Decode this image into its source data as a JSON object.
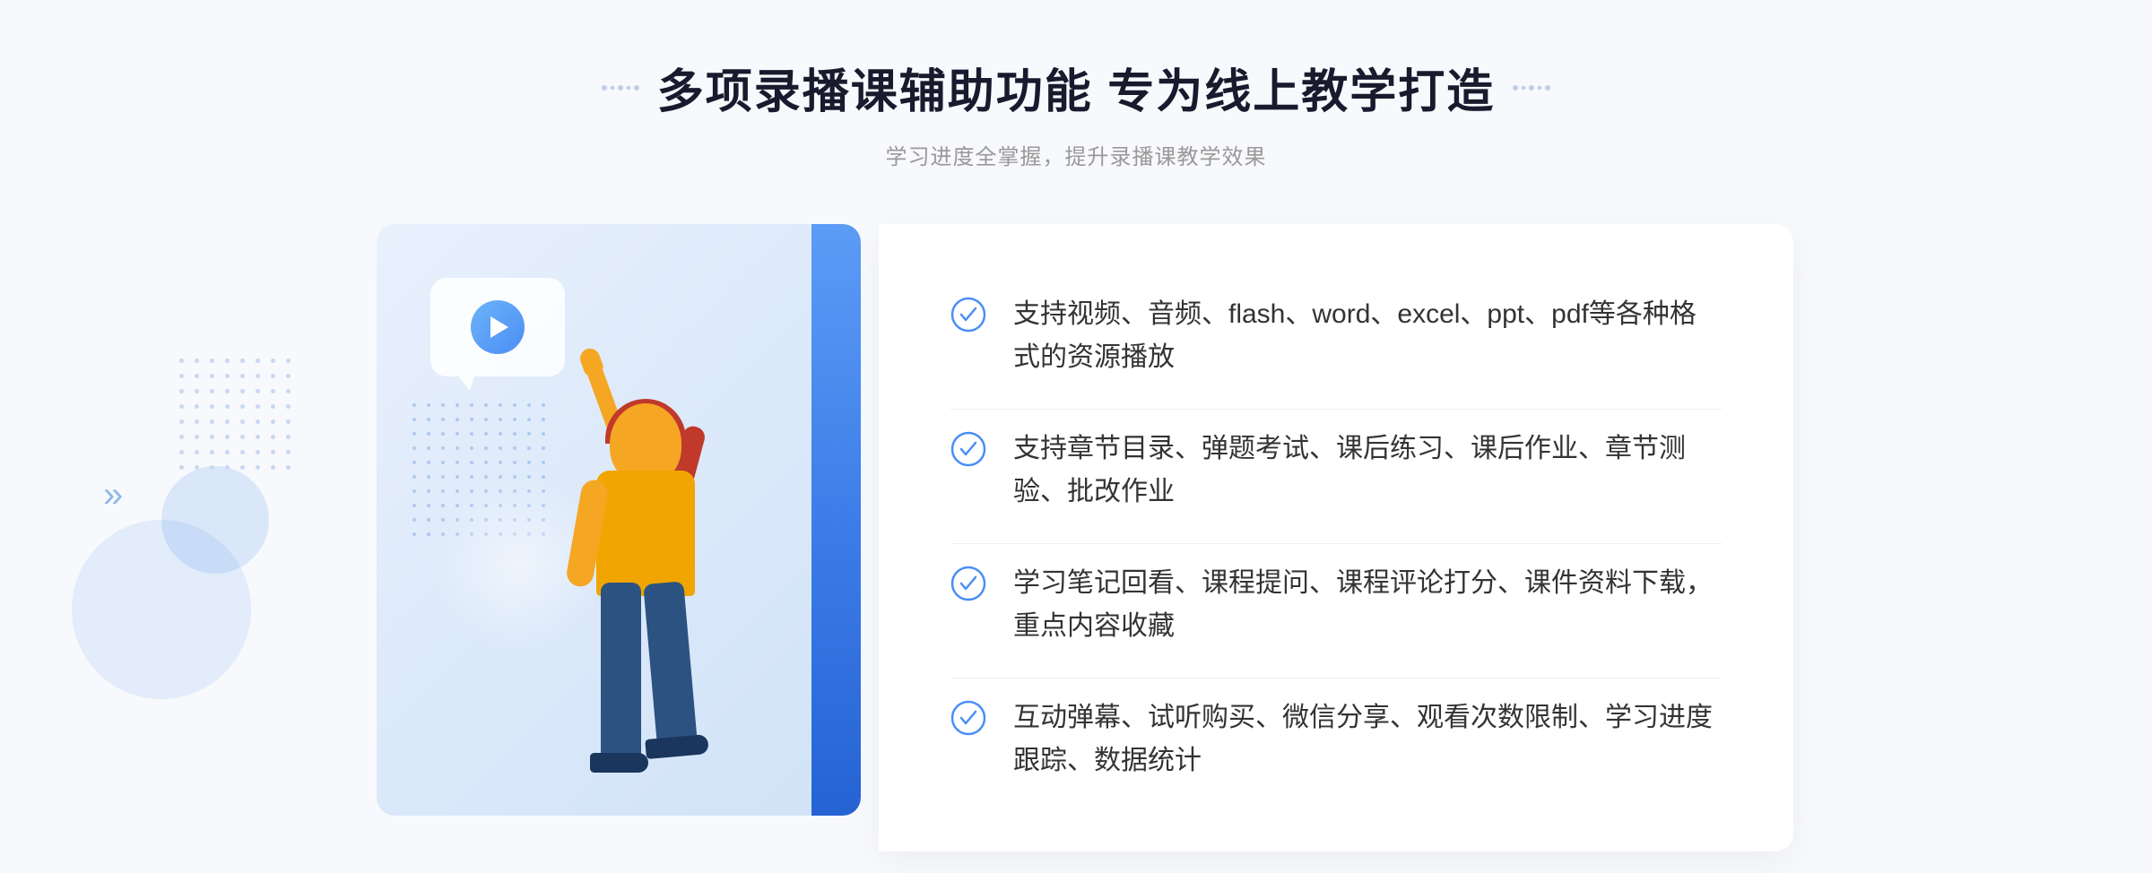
{
  "page": {
    "background_color": "#f8f9fc"
  },
  "header": {
    "title": "多项录播课辅助功能 专为线上教学打造",
    "subtitle": "学习进度全掌握，提升录播课教学效果",
    "decorator_left": "decorative-dots",
    "decorator_right": "decorative-dots"
  },
  "features": [
    {
      "id": 1,
      "text": "支持视频、音频、flash、word、excel、ppt、pdf等各种格式的资源播放",
      "icon": "check-circle-icon"
    },
    {
      "id": 2,
      "text": "支持章节目录、弹题考试、课后练习、课后作业、章节测验、批改作业",
      "icon": "check-circle-icon"
    },
    {
      "id": 3,
      "text": "学习笔记回看、课程提问、课程评论打分、课件资料下载，重点内容收藏",
      "icon": "check-circle-icon"
    },
    {
      "id": 4,
      "text": "互动弹幕、试听购买、微信分享、观看次数限制、学习进度跟踪、数据统计",
      "icon": "check-circle-icon"
    }
  ],
  "colors": {
    "accent_blue": "#4a8ef5",
    "text_dark": "#333333",
    "text_light": "#999999",
    "check_blue": "#4a8ef5",
    "border_light": "#f0f0f0"
  }
}
